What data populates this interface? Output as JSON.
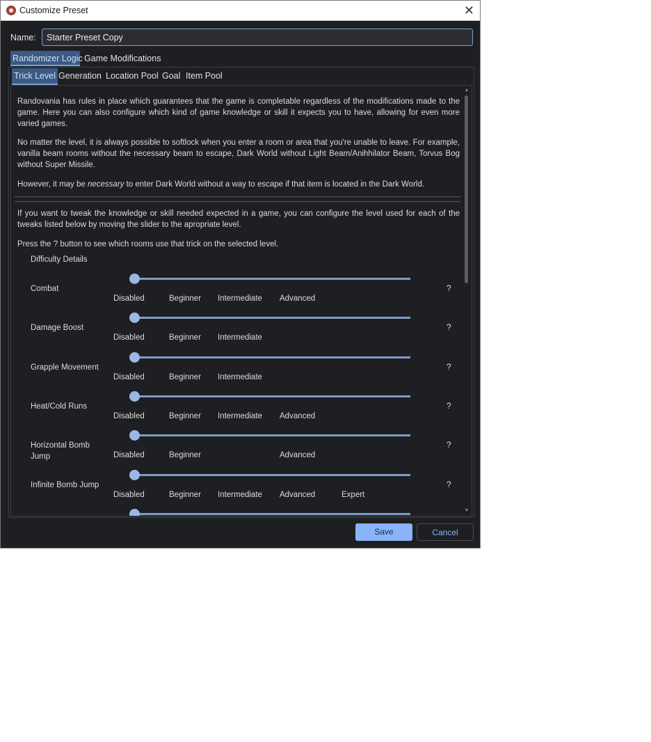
{
  "window": {
    "title": "Customize Preset",
    "close_glyph": "✕"
  },
  "name": {
    "label": "Name:",
    "value": "Starter Preset Copy"
  },
  "top_tabs": [
    "Randomizer Logic",
    "Game Modifications"
  ],
  "sub_tabs": [
    "Trick Level",
    "Generation",
    "Location Pool",
    "Goal",
    "Item Pool"
  ],
  "intro": {
    "p1": "Randovania has rules in place which guarantees that the game is completable regardless of the modifications made to the game. Here you can also configure which kind of game knowledge or skill it expects you to have, allowing for even more varied games.",
    "p2": "No matter the level, it is always possible to softlock when you enter a room or area that you're unable to leave. For example, vanilla beam rooms without the necessary beam to escape, Dark World without Light Beam/Anihhilator Beam, Torvus Bog without Super Missile.",
    "p3_before": "However, it may be ",
    "p3_em": "necessary",
    "p3_after": " to enter Dark World without a way to escape if that item is located in the Dark World.",
    "p4": "If you want to tweak the knowledge or skill needed expected in a game, you can configure the level used for each of the tweaks listed below by moving the slider to the apropriate level.",
    "p5": "Press the ? button to see which rooms use that trick on the selected level."
  },
  "difficulty_header": "Difficulty Details",
  "tricks": [
    {
      "name": "Combat",
      "levels": [
        "Disabled",
        "Beginner",
        "Intermediate",
        "Advanced",
        ""
      ],
      "slider_fraction": 0
    },
    {
      "name": "Damage Boost",
      "levels": [
        "Disabled",
        "Beginner",
        "Intermediate",
        "",
        ""
      ],
      "slider_fraction": 0
    },
    {
      "name": "Grapple Movement",
      "levels": [
        "Disabled",
        "Beginner",
        "Intermediate",
        "",
        ""
      ],
      "slider_fraction": 0
    },
    {
      "name": "Heat/Cold Runs",
      "levels": [
        "Disabled",
        "Beginner",
        "Intermediate",
        "Advanced",
        ""
      ],
      "slider_fraction": 0
    },
    {
      "name": "Horizontal Bomb Jump",
      "levels": [
        "Disabled",
        "Beginner",
        "",
        "Advanced",
        ""
      ],
      "slider_fraction": 0
    },
    {
      "name": "Infinite Bomb Jump",
      "levels": [
        "Disabled",
        "Beginner",
        "Intermediate",
        "Advanced",
        "Expert"
      ],
      "slider_fraction": 0
    },
    {
      "name": "",
      "levels": [
        "",
        "",
        "",
        "",
        ""
      ],
      "slider_fraction": 0
    }
  ],
  "help_button_label": "?",
  "buttons": {
    "save": "Save",
    "cancel": "Cancel"
  },
  "colors": {
    "accent": "#8ab4f8",
    "background": "#1e1f22"
  }
}
